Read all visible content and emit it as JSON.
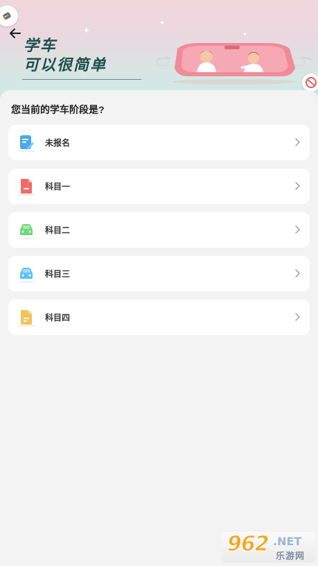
{
  "header": {
    "slogan_line1": "学车",
    "slogan_line2": "可以很简单"
  },
  "question": "您当前的学车阶段是?",
  "stages": [
    {
      "label": "未报名",
      "icon": "form-edit-icon",
      "color": "#4aa8ea"
    },
    {
      "label": "科目一",
      "icon": "document-icon",
      "color": "#f26b6b"
    },
    {
      "label": "科目二",
      "icon": "car-icon",
      "color": "#6fd77a"
    },
    {
      "label": "科目三",
      "icon": "car-icon",
      "color": "#5cc3f2"
    },
    {
      "label": "科目四",
      "icon": "document-icon",
      "color": "#f5c25a"
    }
  ],
  "watermark": {
    "number": "962",
    "domain": ".NET",
    "subtitle": "乐游网"
  }
}
